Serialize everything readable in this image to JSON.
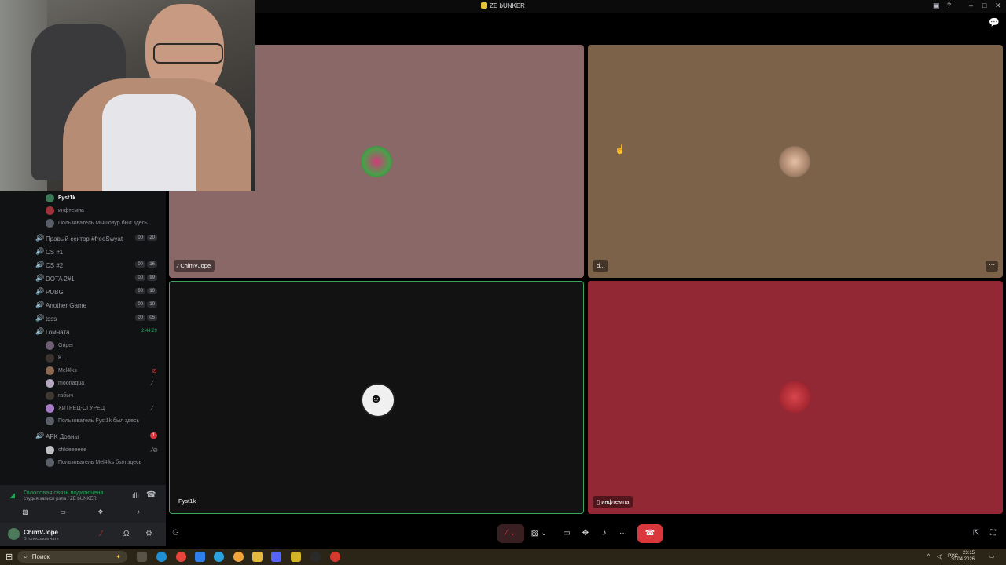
{
  "window": {
    "title": "ZE bUNKER",
    "minimize": "–",
    "maximize": "□",
    "close": "✕"
  },
  "sidebar": {
    "top_users": [
      {
        "name": "Fyst1k",
        "status": ""
      },
      {
        "name": "инфтемпа",
        "status": ""
      },
      {
        "name": "Пользователь Мышовур был здесь",
        "status": ""
      }
    ],
    "channels": [
      {
        "name": "Правый сектор #freeSwyat",
        "count_a": "00",
        "count_b": "20"
      },
      {
        "name": "CS #1",
        "count_a": "",
        "count_b": ""
      },
      {
        "name": "CS #2",
        "count_a": "00",
        "count_b": "16"
      },
      {
        "name": "DOTA 2#1",
        "count_a": "00",
        "count_b": "99"
      },
      {
        "name": "PUBG",
        "count_a": "00",
        "count_b": "10"
      },
      {
        "name": "Another Game",
        "count_a": "00",
        "count_b": "10"
      },
      {
        "name": "tsss",
        "count_a": "00",
        "count_b": "05"
      }
    ],
    "active_channel": {
      "name": "Гомната",
      "timer": "2:44:29"
    },
    "active_users": [
      {
        "name": "Griper",
        "status": ""
      },
      {
        "name": "K...",
        "status": ""
      },
      {
        "name": "Mel4lks",
        "status": ""
      },
      {
        "name": "moonaqua",
        "status": ""
      },
      {
        "name": "габыч",
        "status": ""
      },
      {
        "name": "ХИТРЕЦ-ОГУРЕЦ",
        "status": ""
      },
      {
        "name": "Пользователь Fyst1k был здесь",
        "status": ""
      }
    ],
    "afk_channel": {
      "name": "AFK Довны",
      "badge": "1"
    },
    "afk_users": [
      {
        "name": "chloeeeeee",
        "status": ""
      },
      {
        "name": "Пользователь Mel4lks был здесь",
        "status": ""
      }
    ]
  },
  "voice_panel": {
    "connected": "Голосовая связь подключена",
    "location": "студия записи рэпа / ZE bUNKER"
  },
  "user_bar": {
    "username": "ChimVJope",
    "status": "В голосовом чате"
  },
  "tiles": [
    {
      "label": "ChimVJope",
      "bg": "#8a6868"
    },
    {
      "label": "d...",
      "bg": "#7d624a"
    },
    {
      "label": "Fyst1k",
      "bg": "#121212"
    },
    {
      "label": "инфтемпа",
      "bg": "#922833"
    }
  ],
  "taskbar": {
    "search_placeholder": "Поиск",
    "lang": "РУС",
    "time": "23:15",
    "date": "30.04.2026"
  },
  "colors": {
    "speaking_border": "#3ba55c",
    "hangup": "#da373c",
    "connected": "#23a55a"
  }
}
